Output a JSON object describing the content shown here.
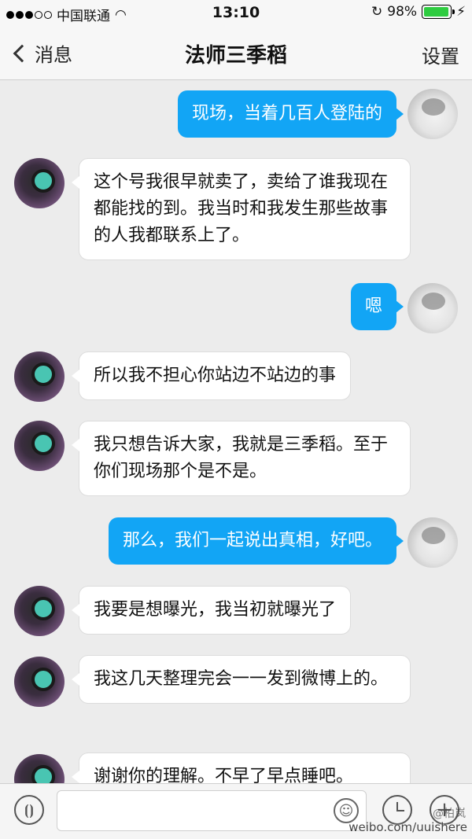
{
  "status_bar": {
    "carrier": "中国联通",
    "time": "13:10",
    "battery": "98%",
    "battery_level": 0.98,
    "signal_bars": 3,
    "signal_total": 5
  },
  "nav": {
    "back_label": "消息",
    "title": "法师三季稻",
    "settings_label": "设置"
  },
  "messages": [
    {
      "from": "me",
      "text": "现场，当着几百人登陆的"
    },
    {
      "from": "them",
      "text": "这个号我很早就卖了，卖给了谁我现在都能找的到。我当时和我发生那些故事的人我都联系上了。"
    },
    {
      "from": "me",
      "text": "嗯"
    },
    {
      "from": "them",
      "text": "所以我不担心你站边不站边的事"
    },
    {
      "from": "them",
      "text": "我只想告诉大家，我就是三季稻。至于你们现场那个是不是。"
    },
    {
      "from": "me",
      "text": "那么，我们一起说出真相，好吧。"
    },
    {
      "from": "them",
      "text": "我要是想曝光，我当初就曝光了"
    },
    {
      "from": "them",
      "text": "我这几天整理完会一一发到微博上的。"
    },
    {
      "from": "them",
      "text": "谢谢你的理解。不早了早点睡吧。"
    }
  ],
  "input_bar": {
    "voice_icon": "voice-icon",
    "emoji_icon": "emoji-icon",
    "clock_icon": "clock-icon",
    "plus_icon": "plus-icon"
  },
  "watermark_top": "@柏岚",
  "watermark": "weibo.com/uuishere",
  "colors": {
    "outgoing_bubble": "#12a5f5",
    "incoming_bubble": "#ffffff",
    "background": "#ececec"
  }
}
